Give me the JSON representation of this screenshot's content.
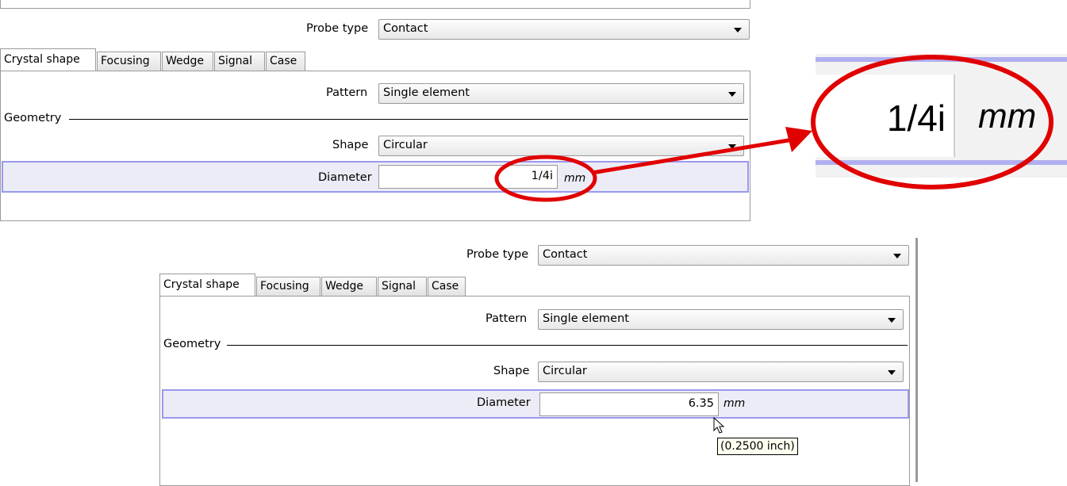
{
  "panel_top": {
    "probe_type_label": "Probe type",
    "probe_type_value": "Contact",
    "tabs": [
      "Crystal shape",
      "Focusing",
      "Wedge",
      "Signal",
      "Case"
    ],
    "pattern_label": "Pattern",
    "pattern_value": "Single element",
    "geometry_label": "Geometry",
    "shape_label": "Shape",
    "shape_value": "Circular",
    "diameter_label": "Diameter",
    "diameter_value": "1/4i",
    "diameter_unit": "mm"
  },
  "zoom": {
    "value": "1/4i",
    "unit": "mm"
  },
  "panel_bottom": {
    "probe_type_label": "Probe type",
    "probe_type_value": "Contact",
    "tabs": [
      "Crystal shape",
      "Focusing",
      "Wedge",
      "Signal",
      "Case"
    ],
    "pattern_label": "Pattern",
    "pattern_value": "Single element",
    "geometry_label": "Geometry",
    "shape_label": "Shape",
    "shape_value": "Circular",
    "diameter_label": "Diameter",
    "diameter_value": "6.35",
    "diameter_unit": "mm",
    "tooltip": "(0.2500 inch)"
  },
  "annotation_colors": {
    "highlight": "#e00000",
    "row_highlight_border": "#9999ee"
  }
}
